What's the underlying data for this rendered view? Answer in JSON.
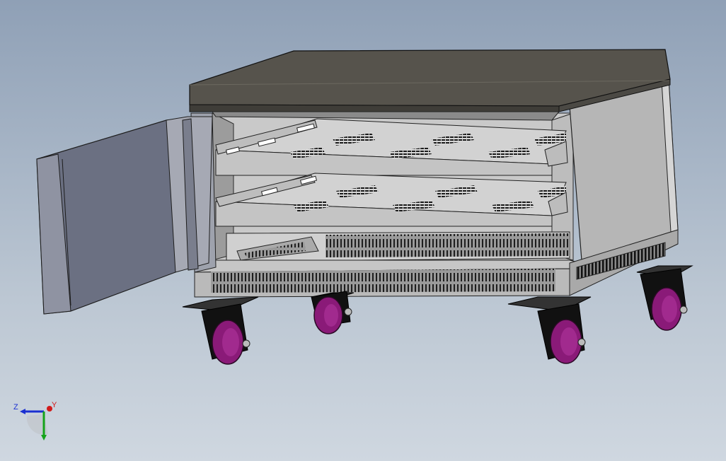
{
  "viewport": {
    "background_top": "#8fa0b6",
    "background_bottom": "#cfd7e0"
  },
  "model": {
    "top_color": "#56534c",
    "body_color": "#b0b0b0",
    "door_color": "#6b7082",
    "wheel_color": "#8a1a78",
    "fork_color": "#111111"
  },
  "triad": {
    "z_label": "Z",
    "y_label": "Y",
    "z_color": "#1a2fd1",
    "y_color": "#d11a1a",
    "x_color": "#15a31a",
    "icon": "axis-triad-icon"
  }
}
